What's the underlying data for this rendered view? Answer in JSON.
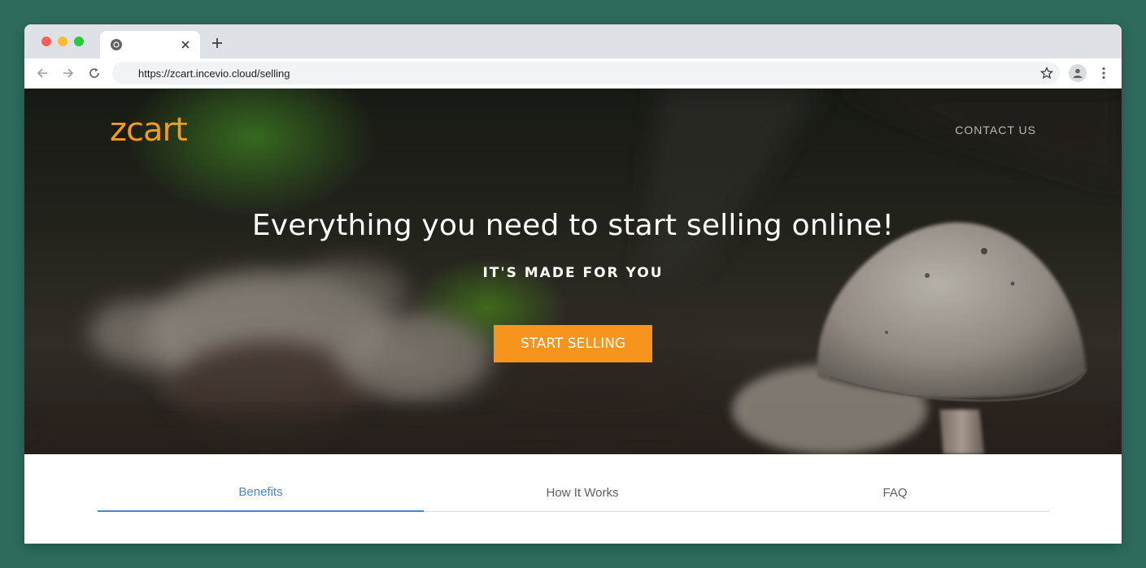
{
  "browser": {
    "tab_title": "",
    "new_tab_icon": "plus-icon",
    "url": "https://zcart.incevio.cloud/selling"
  },
  "header": {
    "logo_text": "zcart",
    "contact_label": "CONTACT US"
  },
  "hero": {
    "headline": "Everything you need to start selling online!",
    "subheadline": "IT'S MADE FOR YOU",
    "cta_label": "START SELLING"
  },
  "tabs": [
    {
      "label": "Benefits",
      "active": true
    },
    {
      "label": "How It Works",
      "active": false
    },
    {
      "label": "FAQ",
      "active": false
    }
  ],
  "colors": {
    "background": "#2e6b5d",
    "accent_orange": "#f7941d",
    "active_tab_blue": "#4a86d6"
  }
}
